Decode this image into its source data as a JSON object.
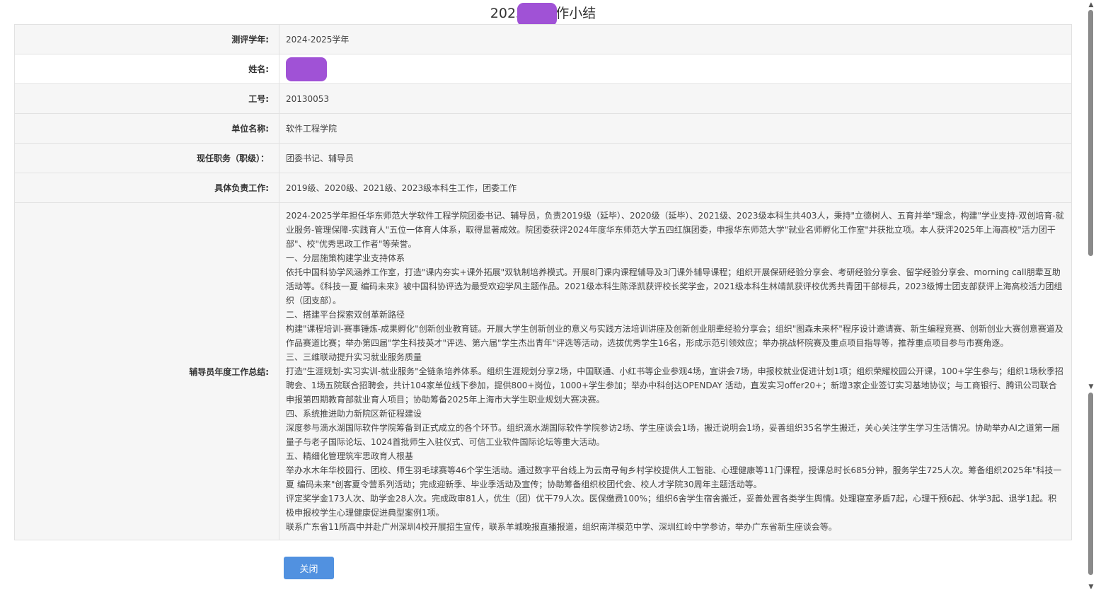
{
  "page": {
    "title": "2025年        工作小结"
  },
  "form": {
    "rows": [
      {
        "label": "测评学年:",
        "value": "2024-2025学年"
      },
      {
        "label": "姓名:",
        "value": ""
      },
      {
        "label": "工号:",
        "value": "20130053"
      },
      {
        "label": "单位名称:",
        "value": "软件工程学院"
      },
      {
        "label": "现任职务（职级）：",
        "value": "团委书记、辅导员"
      },
      {
        "label": "具体负责工作:",
        "value": "2019级、2020级、2021级、2023级本科生工作，团委工作"
      }
    ],
    "summary_label": "辅导员年度工作总结:",
    "summary_lines": [
      "2024-2025学年担任华东师范大学软件工程学院团委书记、辅导员，负责2019级（延毕）、2020级（延毕）、2021级、2023级本科生共403人，秉持\"立德树人、五育并举\"理念，构建\"学业支持-双创培育-就业服务-管理保障-实践育人\"五位一体育人体系，取得显著成效。院团委获评2024年度华东师范大学五四红旗团委，申报华东师范大学\"就业名师孵化工作室\"并获批立项。本人获评2025年上海高校\"活力团干部\"、校\"优秀思政工作者\"等荣誉。",
      "一、分层施策构建学业支持体系",
      "依托中国科协学风涵养工作室，打造\"课内夯实+课外拓展\"双轨制培养模式。开展8门课内课程辅导及3门课外辅导课程；组织开展保研经验分享会、考研经验分享会、留学经验分享会、morning call朋辈互助活动等。《科技一夏 编码未来》被中国科协评选为最受欢迎学风主题作品。2021级本科生陈泽凯获评校长奖学金，2021级本科生林靖凯获评校优秀共青团干部标兵，2023级博士团支部获评上海高校活力团组织（团支部）。",
      "二、搭建平台探索双创革新路径",
      "构建\"课程培训-赛事锤炼-成果孵化\"创新创业教育链。开展大学生创新创业的意义与实践方法培训讲座及创新创业朋辈经验分享会；组织\"图森未来杯\"程序设计邀请赛、新生编程竞赛、创新创业大赛创意赛道及作品赛道比赛；举办第四届\"学生科技英才\"评选、第六届\"学生杰出青年\"评选等活动，选拔优秀学生16名，形成示范引领效应；举办挑战杯院赛及重点项目指导等，推荐重点项目参与市赛角逐。",
      "三、三维联动提升实习就业服务质量",
      "打造\"生涯规划-实习实训-就业服务\"全链条培养体系。组织生涯规划分享2场，中国联通、小红书等企业参观4场，宣讲会7场，申报校就业促进计划1项；组织荣耀校园公开课，100+学生参与；组织1场秋季招聘会、1场五院联合招聘会，共计104家单位线下参加，提供800+岗位，1000+学生参加；举办中科创达OPENDAY 活动，直发实习offer20+；新增3家企业签订实习基地协议；与工商银行、腾讯公司联合申报第四期教育部就业育人项目；协助筹备2025年上海市大学生职业规划大赛决赛。",
      "四、系统推进助力新院区新征程建设",
      "深度参与滴水湖国际软件学院筹备到正式成立的各个环节。组织滴水湖国际软件学院参访2场、学生座谈会1场，搬迁说明会1场，妥善组织35名学生搬迁，关心关注学生学习生活情况。协助举办AI之道第一届量子与老子国际论坛、1024首批师生入驻仪式、可信工业软件国际论坛等重大活动。",
      "五、精细化管理筑牢思政育人根基",
      "举办水木年华校园行、团校、师生羽毛球赛等46个学生活动。通过数字平台线上为云南寻甸乡村学校提供人工智能、心理健康等11门课程，授课总时长685分钟，服务学生725人次。筹备组织2025年\"科技一夏 编码未来\"创客夏令营系列活动；完成迎新季、毕业季活动及宣传；协助筹备组织校团代会、校人才学院30周年主题活动等。",
      "评定奖学金173人次、助学金28人次。完成政审81人，优生（团）优干79人次。医保缴费100%；组织6舍学生宿舍搬迁，妥善处置各类学生舆情。处理寝室矛盾7起，心理干预6起、休学3起、退学1起。积极申报校学生心理健康促进典型案例1项。",
      "联系广东省11所高中并赴广州深圳4校开展招生宣传，联系羊城晚报直播报道，组织南洋模范中学、深圳红岭中学参访，举办广东省新生座谈会等。"
    ]
  },
  "actions": {
    "close_label": "关闭"
  }
}
